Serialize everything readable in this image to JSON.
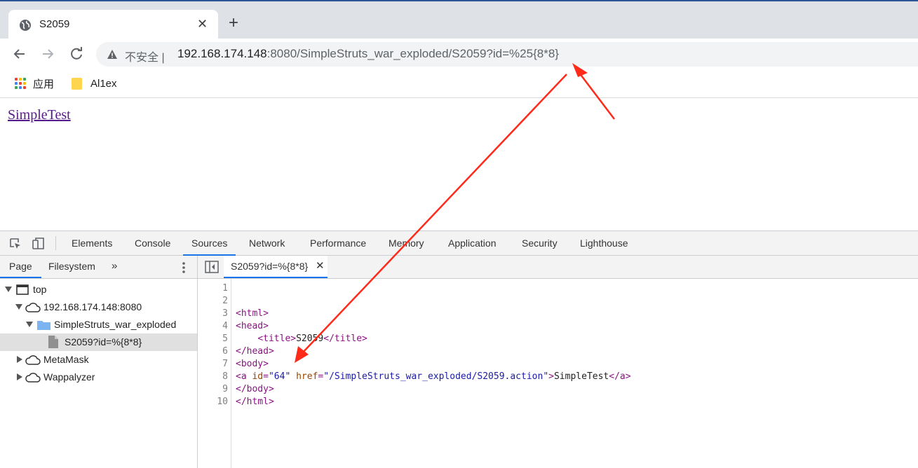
{
  "browser": {
    "tab_title": "S2059",
    "tab_close": "✕",
    "new_tab": "+",
    "security_label": "不安全",
    "security_sep": "|",
    "url_host": "192.168.174.148",
    "url_rest": ":8080/SimpleStruts_war_exploded/S2059?id=%25{8*8}"
  },
  "bookmarks": [
    {
      "label": "应用",
      "icon": "apps-grid-icon"
    },
    {
      "label": "Al1ex",
      "icon": "folder-icon"
    }
  ],
  "page": {
    "link_text": "SimpleTest"
  },
  "devtools": {
    "tabs": [
      "Elements",
      "Console",
      "Sources",
      "Network",
      "Performance",
      "Memory",
      "Application",
      "Security",
      "Lighthouse"
    ],
    "active_tab": "Sources",
    "navigator_tabs": [
      "Page",
      "Filesystem"
    ],
    "navigator_more": "»",
    "tree": [
      {
        "label": "top",
        "icon": "frame-icon",
        "expanded": true
      },
      {
        "label": "192.168.174.148:8080",
        "icon": "cloud-icon",
        "expanded": true
      },
      {
        "label": "SimpleStruts_war_exploded",
        "icon": "folder-icon",
        "expanded": true
      },
      {
        "label": "S2059?id=%{8*8}",
        "icon": "file-icon",
        "selected": true
      },
      {
        "label": "MetaMask",
        "icon": "cloud-icon",
        "expanded": false
      },
      {
        "label": "Wappalyzer",
        "icon": "cloud-icon",
        "expanded": false
      }
    ],
    "editor_tab": "S2059?id=%{8*8}",
    "editor_tab_close": "✕",
    "line_numbers": [
      "1",
      "2",
      "3",
      "4",
      "5",
      "6",
      "7",
      "8",
      "9",
      "10"
    ],
    "code": {
      "l3": "<html>",
      "l4": "<head>",
      "l5_indent": "    ",
      "l5_open": "<title>",
      "l5_text": "S2059",
      "l5_close": "</title>",
      "l6": "</head>",
      "l7": "<body>",
      "l8_open": "<a",
      "l8_attr1": " id",
      "l8_eq1": "=",
      "l8_val1": "\"64\"",
      "l8_attr2": " href",
      "l8_eq2": "=",
      "l8_val2": "\"/SimpleStruts_war_exploded/S2059.action\"",
      "l8_gt": ">",
      "l8_text": "SimpleTest",
      "l8_close": "</a>",
      "l9": "</body>",
      "l10": "</html>"
    }
  },
  "colors": {
    "accent": "#1a73e8",
    "annotation_arrow": "#ff2a1a",
    "link_visited": "#551a8b"
  }
}
